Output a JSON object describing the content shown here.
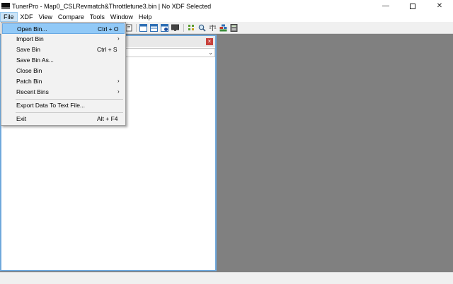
{
  "window": {
    "title": "TunerPro - Map0_CSLRevmatch&Throttletune3.bin | No XDF Selected",
    "minimize_glyph": "—",
    "close_glyph": "✕"
  },
  "menubar": {
    "items": [
      "File",
      "XDF",
      "View",
      "Compare",
      "Tools",
      "Window",
      "Help"
    ]
  },
  "file_menu": {
    "items": [
      {
        "label": "Open Bin...",
        "shortcut": "Ctrl + O"
      },
      {
        "label": "Import Bin",
        "submenu": "›"
      },
      {
        "label": "Save Bin",
        "shortcut": "Ctrl + S"
      },
      {
        "label": "Save Bin As..."
      },
      {
        "label": "Close Bin"
      },
      {
        "label": "Patch Bin",
        "submenu": "›"
      },
      {
        "label": "Recent Bins",
        "submenu": "›"
      },
      {
        "label": "Export Data To Text File..."
      },
      {
        "label": "Exit",
        "shortcut": "Alt + F4"
      }
    ]
  },
  "panel": {
    "close_glyph": "×",
    "combo_arrow": "⌄"
  },
  "colors": {
    "accent": "#91c9f7",
    "mdi_background": "#808080",
    "panel_border": "#6fa8dc",
    "close_red": "#c8413c"
  },
  "toolbar_icons": [
    "page-icon",
    "window-icon",
    "window-split-icon",
    "info-window-icon",
    "display-icon",
    "grid-icon",
    "magnifier-icon",
    "scale-icon",
    "stack-icon",
    "calculator-icon"
  ]
}
